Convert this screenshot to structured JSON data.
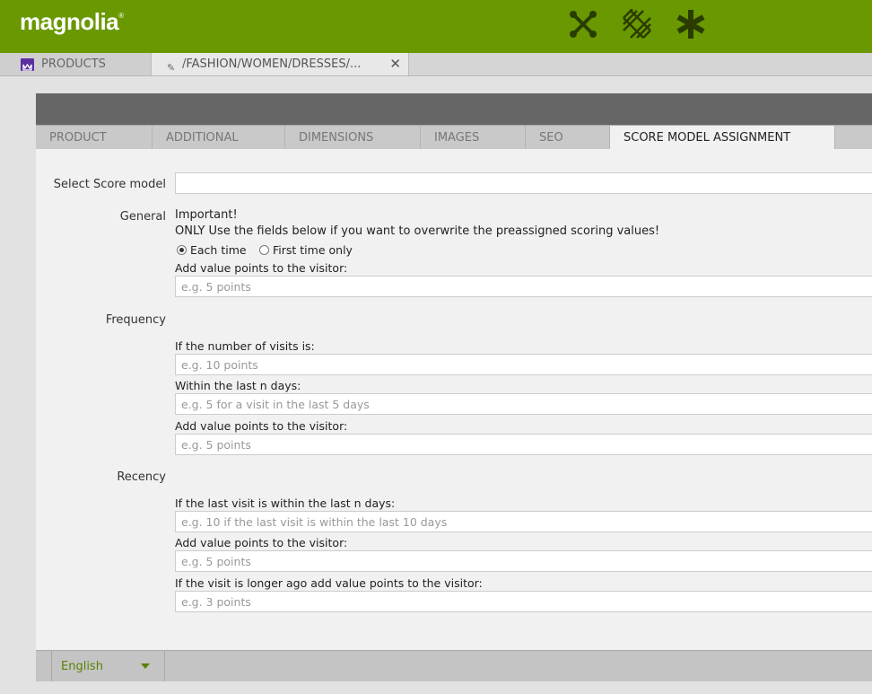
{
  "header": {
    "logo_text": "magnolia",
    "logo_mark": "®",
    "colors": {
      "brand_green": "#6a9800",
      "accent_purple": "#5c2fa0"
    },
    "app_icons": [
      "pulse-cross-icon",
      "diamond-grid-icon",
      "asterisk-icon"
    ]
  },
  "tabs": [
    {
      "label": "PRODUCTS",
      "icon": "products-app-icon"
    },
    {
      "label": "/FASHION/WOMEN/DRESSES/...",
      "icon": "pencil-icon",
      "close": "✕"
    }
  ],
  "form_tabs": [
    "PRODUCT",
    "ADDITIONAL",
    "DIMENSIONS",
    "IMAGES",
    "SEO",
    "SCORE MODEL ASSIGNMENT"
  ],
  "form": {
    "select_score_model": {
      "label": "Select Score model",
      "value": ""
    },
    "general": {
      "label": "General",
      "important": "Important!",
      "note": "ONLY Use the fields below if you want to overwrite the preassigned scoring values!",
      "radio_each": "Each time",
      "radio_first": "First time only",
      "selected": "Each time",
      "points_label": "Add value points to the visitor:",
      "points_placeholder": "e.g. 5 points"
    },
    "frequency": {
      "label": "Frequency",
      "visits_label": "If the number of visits is:",
      "visits_placeholder": "e.g. 10 points",
      "days_label": "Within the last n days:",
      "days_placeholder": "e.g. 5 for a visit in the last 5 days",
      "points_label": "Add value points to the visitor:",
      "points_placeholder": "e.g. 5 points"
    },
    "recency": {
      "label": "Recency",
      "last_visit_label": "If the last visit is within the last n days:",
      "last_visit_placeholder": "e.g. 10 if the last visit is within the last 10 days",
      "points_label": "Add value points to the visitor:",
      "points_placeholder": "e.g. 5 points",
      "older_label": "If the visit is longer ago add value points to the visitor:",
      "older_placeholder": "e.g. 3 points"
    }
  },
  "footer": {
    "language": "English"
  }
}
